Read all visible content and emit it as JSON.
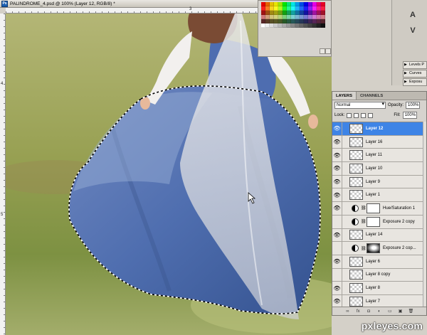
{
  "document": {
    "title": "PALINDROME_4.psd @ 100% (Layer 12, RGB/8) *",
    "app_icon": "Ps"
  },
  "rulers": {
    "top_label": "3",
    "left_labels": [
      "4",
      "5"
    ]
  },
  "dock": {
    "icons": [
      "character-icon",
      "paragraph-icon"
    ],
    "icon_glyphs": [
      "A",
      "V"
    ],
    "mini_panels": [
      "Levels P",
      "Curves",
      "Exposu"
    ]
  },
  "layers_panel": {
    "tabs": [
      "LAYERS",
      "CHANNELS"
    ],
    "blend_mode": "Normal",
    "opacity_label": "Opacity:",
    "opacity_value": "100%",
    "lock_label": "Lock:",
    "fill_label": "Fill:",
    "fill_value": "100%",
    "layers": [
      {
        "name": "Layer 12",
        "visible": true,
        "selected": true,
        "kind": "pixel"
      },
      {
        "name": "Layer 16",
        "visible": true,
        "selected": false,
        "kind": "pixel"
      },
      {
        "name": "Layer 11",
        "visible": true,
        "selected": false,
        "kind": "pixel"
      },
      {
        "name": "Layer 10",
        "visible": true,
        "selected": false,
        "kind": "pixel"
      },
      {
        "name": "Layer 9",
        "visible": true,
        "selected": false,
        "kind": "pixel"
      },
      {
        "name": "Layer 1",
        "visible": true,
        "selected": false,
        "kind": "pixel"
      },
      {
        "name": "Hue/Saturation 1",
        "visible": true,
        "selected": false,
        "kind": "adjustment"
      },
      {
        "name": "Exposure 2 copy",
        "visible": false,
        "selected": false,
        "kind": "adjustment"
      },
      {
        "name": "Layer 14",
        "visible": true,
        "selected": false,
        "kind": "pixel"
      },
      {
        "name": "Exposure 2 cop...",
        "visible": false,
        "selected": false,
        "kind": "adjustment-blob"
      },
      {
        "name": "Layer 6",
        "visible": true,
        "selected": false,
        "kind": "pixel"
      },
      {
        "name": "Layer 8 copy",
        "visible": false,
        "selected": false,
        "kind": "pixel"
      },
      {
        "name": "Layer 8",
        "visible": true,
        "selected": false,
        "kind": "pixel"
      },
      {
        "name": "Layer 7",
        "visible": true,
        "selected": false,
        "kind": "pixel"
      }
    ],
    "footer_icons": [
      "link-layers-icon",
      "fx-icon",
      "add-mask-icon",
      "adjustment-icon",
      "group-icon",
      "new-layer-icon",
      "trash-icon"
    ],
    "footer_glyphs": [
      "∞",
      "fx",
      "◘",
      "◐",
      "▭",
      "▣",
      "🗑"
    ]
  },
  "watermark": "pxleyes.com",
  "colors": {
    "selected_row": "#3e84e6",
    "dress": "#4f73b0",
    "grass": "#8c9448"
  }
}
